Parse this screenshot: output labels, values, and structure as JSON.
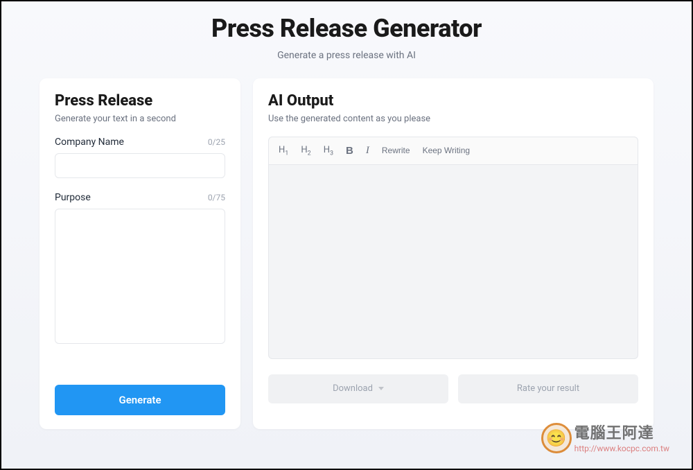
{
  "header": {
    "title": "Press Release Generator",
    "subtitle": "Generate a press release with AI"
  },
  "left": {
    "title": "Press Release",
    "subtitle": "Generate your text in a second",
    "company": {
      "label": "Company Name",
      "count": "0/25",
      "value": ""
    },
    "purpose": {
      "label": "Purpose",
      "count": "0/75",
      "value": ""
    },
    "generate_label": "Generate"
  },
  "right": {
    "title": "AI Output",
    "subtitle": "Use the generated content as you please",
    "toolbar": {
      "h1": "H",
      "h1_sub": "1",
      "h2": "H",
      "h2_sub": "2",
      "h3": "H",
      "h3_sub": "3",
      "bold": "B",
      "italic": "I",
      "rewrite": "Rewrite",
      "keep_writing": "Keep Writing"
    },
    "download_label": "Download",
    "rate_label": "Rate your result"
  },
  "watermark": {
    "title": "電腦王阿達",
    "url": "http://www.kocpc.com.tw"
  }
}
